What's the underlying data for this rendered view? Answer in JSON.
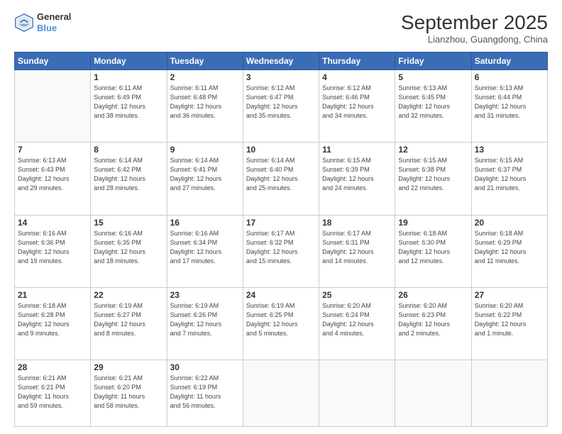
{
  "header": {
    "logo_line1": "General",
    "logo_line2": "Blue",
    "month": "September 2025",
    "location": "Lianzhou, Guangdong, China"
  },
  "weekdays": [
    "Sunday",
    "Monday",
    "Tuesday",
    "Wednesday",
    "Thursday",
    "Friday",
    "Saturday"
  ],
  "weeks": [
    [
      {
        "day": "",
        "info": ""
      },
      {
        "day": "1",
        "info": "Sunrise: 6:11 AM\nSunset: 6:49 PM\nDaylight: 12 hours\nand 38 minutes."
      },
      {
        "day": "2",
        "info": "Sunrise: 6:11 AM\nSunset: 6:48 PM\nDaylight: 12 hours\nand 36 minutes."
      },
      {
        "day": "3",
        "info": "Sunrise: 6:12 AM\nSunset: 6:47 PM\nDaylight: 12 hours\nand 35 minutes."
      },
      {
        "day": "4",
        "info": "Sunrise: 6:12 AM\nSunset: 6:46 PM\nDaylight: 12 hours\nand 34 minutes."
      },
      {
        "day": "5",
        "info": "Sunrise: 6:13 AM\nSunset: 6:45 PM\nDaylight: 12 hours\nand 32 minutes."
      },
      {
        "day": "6",
        "info": "Sunrise: 6:13 AM\nSunset: 6:44 PM\nDaylight: 12 hours\nand 31 minutes."
      }
    ],
    [
      {
        "day": "7",
        "info": "Sunrise: 6:13 AM\nSunset: 6:43 PM\nDaylight: 12 hours\nand 29 minutes."
      },
      {
        "day": "8",
        "info": "Sunrise: 6:14 AM\nSunset: 6:42 PM\nDaylight: 12 hours\nand 28 minutes."
      },
      {
        "day": "9",
        "info": "Sunrise: 6:14 AM\nSunset: 6:41 PM\nDaylight: 12 hours\nand 27 minutes."
      },
      {
        "day": "10",
        "info": "Sunrise: 6:14 AM\nSunset: 6:40 PM\nDaylight: 12 hours\nand 25 minutes."
      },
      {
        "day": "11",
        "info": "Sunrise: 6:15 AM\nSunset: 6:39 PM\nDaylight: 12 hours\nand 24 minutes."
      },
      {
        "day": "12",
        "info": "Sunrise: 6:15 AM\nSunset: 6:38 PM\nDaylight: 12 hours\nand 22 minutes."
      },
      {
        "day": "13",
        "info": "Sunrise: 6:15 AM\nSunset: 6:37 PM\nDaylight: 12 hours\nand 21 minutes."
      }
    ],
    [
      {
        "day": "14",
        "info": "Sunrise: 6:16 AM\nSunset: 6:36 PM\nDaylight: 12 hours\nand 19 minutes."
      },
      {
        "day": "15",
        "info": "Sunrise: 6:16 AM\nSunset: 6:35 PM\nDaylight: 12 hours\nand 18 minutes."
      },
      {
        "day": "16",
        "info": "Sunrise: 6:16 AM\nSunset: 6:34 PM\nDaylight: 12 hours\nand 17 minutes."
      },
      {
        "day": "17",
        "info": "Sunrise: 6:17 AM\nSunset: 6:32 PM\nDaylight: 12 hours\nand 15 minutes."
      },
      {
        "day": "18",
        "info": "Sunrise: 6:17 AM\nSunset: 6:31 PM\nDaylight: 12 hours\nand 14 minutes."
      },
      {
        "day": "19",
        "info": "Sunrise: 6:18 AM\nSunset: 6:30 PM\nDaylight: 12 hours\nand 12 minutes."
      },
      {
        "day": "20",
        "info": "Sunrise: 6:18 AM\nSunset: 6:29 PM\nDaylight: 12 hours\nand 11 minutes."
      }
    ],
    [
      {
        "day": "21",
        "info": "Sunrise: 6:18 AM\nSunset: 6:28 PM\nDaylight: 12 hours\nand 9 minutes."
      },
      {
        "day": "22",
        "info": "Sunrise: 6:19 AM\nSunset: 6:27 PM\nDaylight: 12 hours\nand 8 minutes."
      },
      {
        "day": "23",
        "info": "Sunrise: 6:19 AM\nSunset: 6:26 PM\nDaylight: 12 hours\nand 7 minutes."
      },
      {
        "day": "24",
        "info": "Sunrise: 6:19 AM\nSunset: 6:25 PM\nDaylight: 12 hours\nand 5 minutes."
      },
      {
        "day": "25",
        "info": "Sunrise: 6:20 AM\nSunset: 6:24 PM\nDaylight: 12 hours\nand 4 minutes."
      },
      {
        "day": "26",
        "info": "Sunrise: 6:20 AM\nSunset: 6:23 PM\nDaylight: 12 hours\nand 2 minutes."
      },
      {
        "day": "27",
        "info": "Sunrise: 6:20 AM\nSunset: 6:22 PM\nDaylight: 12 hours\nand 1 minute."
      }
    ],
    [
      {
        "day": "28",
        "info": "Sunrise: 6:21 AM\nSunset: 6:21 PM\nDaylight: 11 hours\nand 59 minutes."
      },
      {
        "day": "29",
        "info": "Sunrise: 6:21 AM\nSunset: 6:20 PM\nDaylight: 11 hours\nand 58 minutes."
      },
      {
        "day": "30",
        "info": "Sunrise: 6:22 AM\nSunset: 6:19 PM\nDaylight: 11 hours\nand 56 minutes."
      },
      {
        "day": "",
        "info": ""
      },
      {
        "day": "",
        "info": ""
      },
      {
        "day": "",
        "info": ""
      },
      {
        "day": "",
        "info": ""
      }
    ]
  ]
}
